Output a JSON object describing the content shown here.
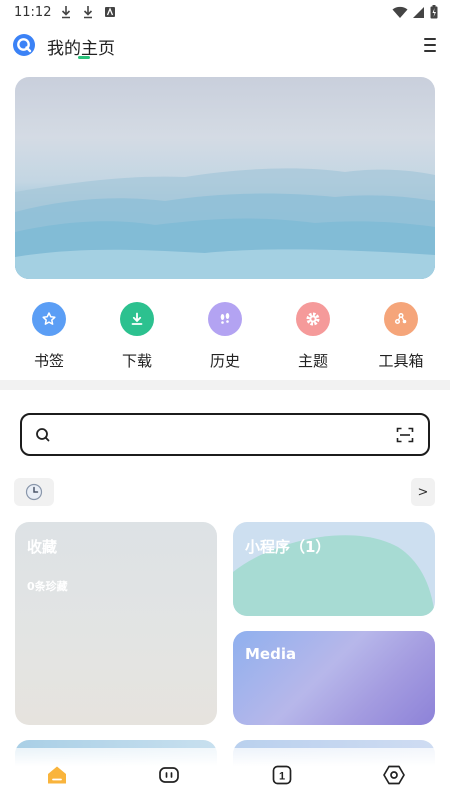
{
  "status_bar": {
    "time": "11:12"
  },
  "header": {
    "title": "我的主页"
  },
  "quick_actions": [
    {
      "label": "书签",
      "icon": "star-icon",
      "color": "#5b9ef5"
    },
    {
      "label": "下载",
      "icon": "download-icon",
      "color": "#2cc18f"
    },
    {
      "label": "历史",
      "icon": "footprints-icon",
      "color": "#b3a3f2"
    },
    {
      "label": "主题",
      "icon": "gear-icon",
      "color": "#f59a9a"
    },
    {
      "label": "工具箱",
      "icon": "toolbox-icon",
      "color": "#f5a57a"
    }
  ],
  "search": {
    "value": "",
    "placeholder": ""
  },
  "more_label": ">",
  "cards": {
    "favorites": {
      "title": "收藏",
      "subtitle": "0条珍藏"
    },
    "mini_programs": {
      "title": "小程序（1）"
    },
    "media": {
      "title": "Media"
    }
  },
  "bottom_nav": [
    {
      "name": "home-icon",
      "active": true
    },
    {
      "name": "chat-icon",
      "active": false
    },
    {
      "name": "tabs-count-icon",
      "count": "1"
    },
    {
      "name": "settings-hex-icon",
      "active": false
    }
  ],
  "colors": {
    "accent": "#28c27a",
    "home_active": "#f9b43c"
  }
}
